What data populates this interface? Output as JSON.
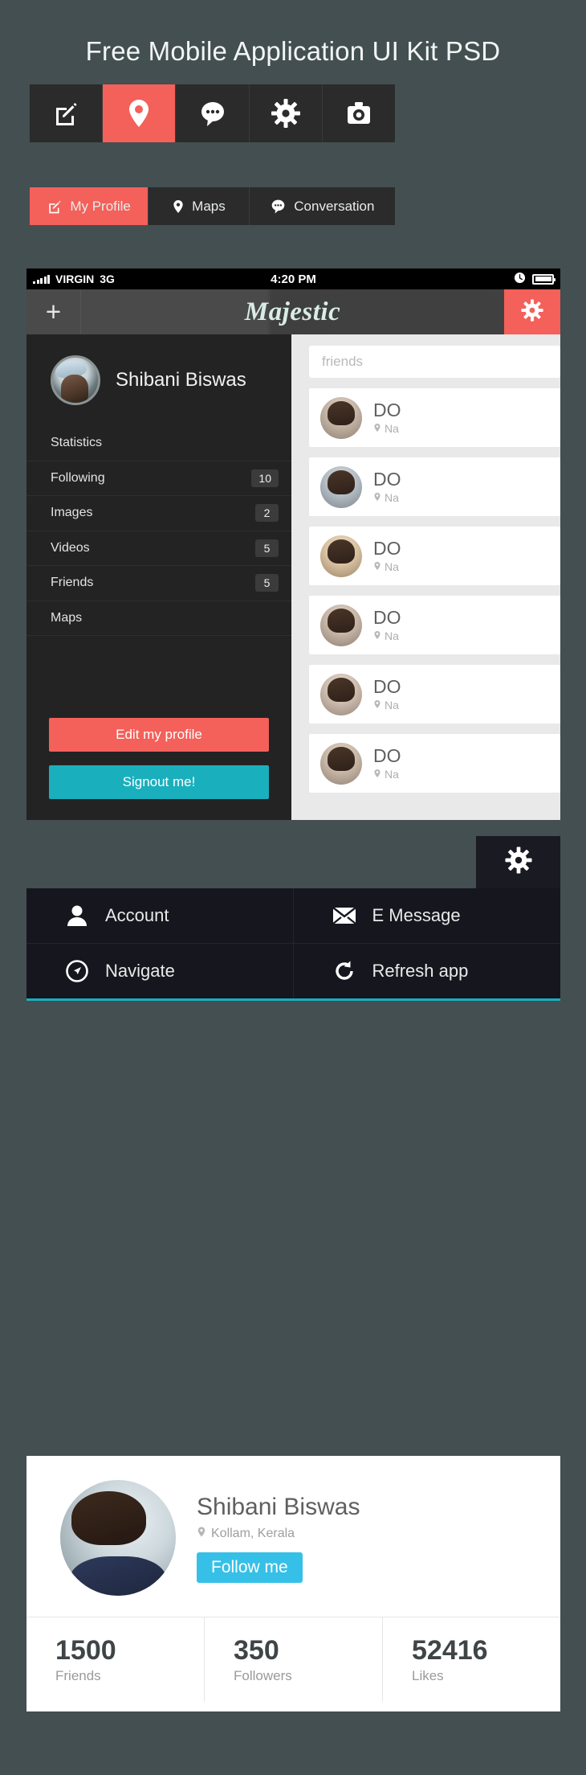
{
  "page": {
    "title": "Free Mobile Application UI Kit PSD",
    "background": "#434f51",
    "accent_red": "#f4605a",
    "accent_teal": "#1aafbd",
    "accent_blue": "#36c0e8"
  },
  "icon_bar": {
    "items": [
      {
        "icon": "edit-icon",
        "active": false
      },
      {
        "icon": "location-pin-icon",
        "active": true
      },
      {
        "icon": "chat-bubble-icon",
        "active": false
      },
      {
        "icon": "gear-icon",
        "active": false
      },
      {
        "icon": "camera-icon",
        "active": false
      }
    ]
  },
  "tab_bar": {
    "tabs": [
      {
        "label": "My Profile",
        "icon": "edit-icon",
        "active": true
      },
      {
        "label": "Maps",
        "icon": "location-pin-icon",
        "active": false
      },
      {
        "label": "Conversation",
        "icon": "chat-bubble-icon",
        "active": false
      }
    ]
  },
  "phone": {
    "statusbar": {
      "carrier": "VIRGIN",
      "network": "3G",
      "time": "4:20 PM",
      "signal_icon": "signal-bars-icon",
      "clock_icon": "clock-icon",
      "battery_icon": "battery-icon"
    },
    "navbar": {
      "add_label": "+",
      "title": "Majestic",
      "gear_icon": "gear-icon"
    },
    "sidebar": {
      "profile_name": "Shibani Biswas",
      "avatar": "user-avatar",
      "section_label": "Statistics",
      "stats": [
        {
          "label": "Following",
          "count": "10"
        },
        {
          "label": "Images",
          "count": "2"
        },
        {
          "label": "Videos",
          "count": "5"
        },
        {
          "label": "Friends",
          "count": "5"
        }
      ],
      "maps_label": "Maps",
      "edit_profile_label": "Edit my profile",
      "signout_label": "Signout me!"
    },
    "friends_panel": {
      "search_placeholder": "friends",
      "friends": [
        {
          "name": "DO",
          "location": "Na",
          "avatar": "friend-avatar-1"
        },
        {
          "name": "DO",
          "location": "Na",
          "avatar": "friend-avatar-2"
        },
        {
          "name": "DO",
          "location": "Na",
          "avatar": "friend-avatar-3"
        },
        {
          "name": "DO",
          "location": "Na",
          "avatar": "friend-avatar-4"
        },
        {
          "name": "DO",
          "location": "Na",
          "avatar": "friend-avatar-5"
        },
        {
          "name": "DO",
          "location": "Na",
          "avatar": "friend-avatar-6"
        }
      ]
    }
  },
  "gear_tab": {
    "icon": "gear-icon"
  },
  "action_grid": {
    "items": [
      {
        "label": "Account",
        "icon": "person-icon"
      },
      {
        "label": "E Message",
        "icon": "envelope-icon"
      },
      {
        "label": "Navigate",
        "icon": "compass-icon"
      },
      {
        "label": "Refresh app",
        "icon": "refresh-icon"
      }
    ]
  },
  "profile_card": {
    "name": "Shibani Biswas",
    "location": "Kollam, Kerala",
    "location_icon": "location-pin-icon",
    "follow_label": "Follow me",
    "avatar": "user-avatar-large",
    "stats": [
      {
        "value": "1500",
        "label": "Friends"
      },
      {
        "value": "350",
        "label": "Followers"
      },
      {
        "value": "52416",
        "label": "Likes"
      }
    ]
  }
}
